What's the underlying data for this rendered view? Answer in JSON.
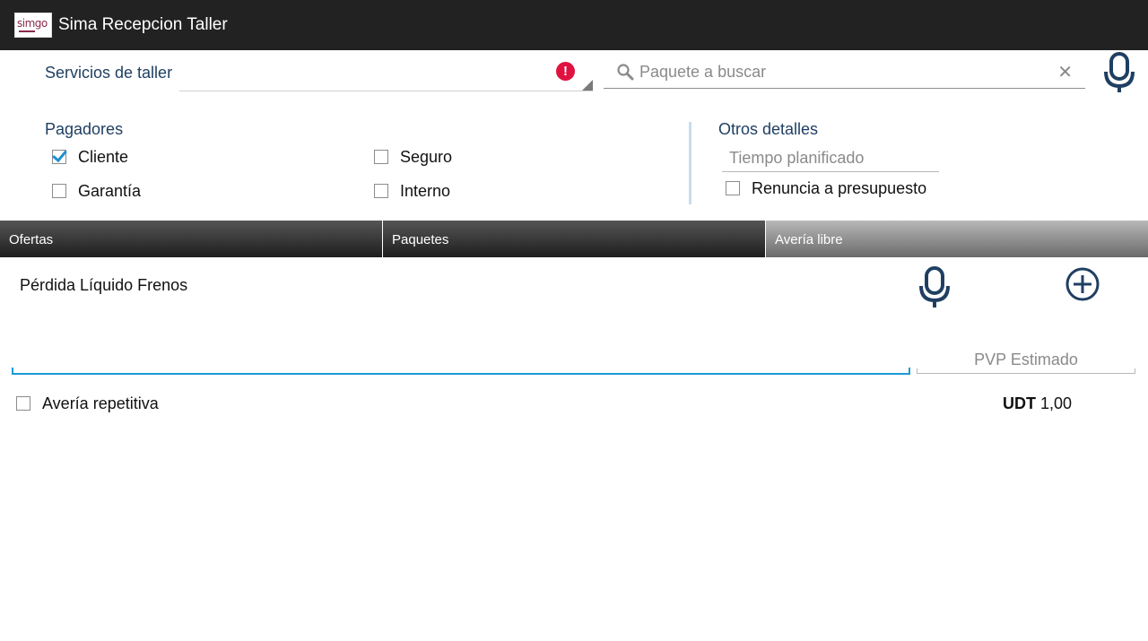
{
  "app": {
    "title": "Sima Recepcion Taller",
    "logo_text": "simgo"
  },
  "top": {
    "servicios_label": "Servicios de taller",
    "search_placeholder": "Paquete a buscar"
  },
  "pagadores": {
    "label": "Pagadores",
    "items": [
      {
        "label": "Cliente",
        "checked": true
      },
      {
        "label": "Seguro",
        "checked": false
      },
      {
        "label": "Garantía",
        "checked": false
      },
      {
        "label": "Interno",
        "checked": false
      }
    ]
  },
  "otros": {
    "label": "Otros detalles",
    "tiempo_placeholder": "Tiempo planificado",
    "renuncia_label": "Renuncia a presupuesto",
    "renuncia_checked": false
  },
  "tabs": [
    {
      "label": "Ofertas",
      "selected": false
    },
    {
      "label": "Paquetes",
      "selected": false
    },
    {
      "label": "Avería libre",
      "selected": true
    }
  ],
  "averia": {
    "description": "Pérdida Líquido Frenos",
    "pvp_placeholder": "PVP Estimado",
    "repetitiva_label": "Avería repetitiva",
    "repetitiva_checked": false,
    "udt_label": "UDT",
    "udt_value": "1,00"
  },
  "colors": {
    "actionbar": "#222222",
    "accent_blue": "#1a9ad6",
    "label_blue": "#1f3f62",
    "error_red": "#e0123f"
  }
}
